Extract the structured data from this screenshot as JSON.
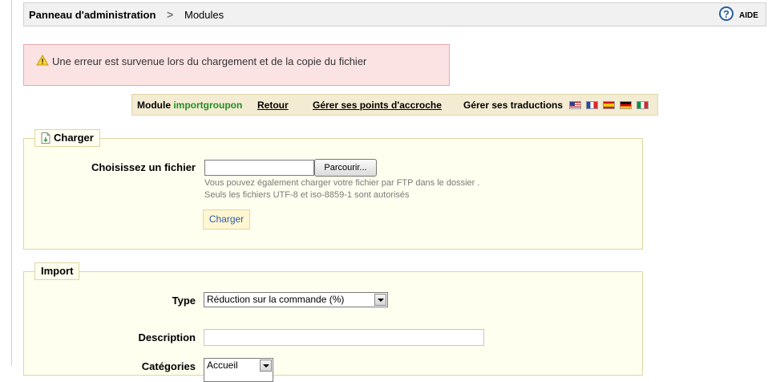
{
  "breadcrumb": {
    "root": "Panneau d'administration",
    "separator": ">",
    "current": "Modules"
  },
  "help": {
    "icon": "help-circle-icon",
    "label": "AIDE"
  },
  "error": {
    "icon": "warning-icon",
    "message": "Une erreur est survenue lors du chargement et de la copie du fichier"
  },
  "toolbar": {
    "module_prefix": "Module",
    "module_name": "importgroupon",
    "back_label": "Retour",
    "hooks_label": "Gérer ses points d'accroche",
    "translations_label": "Gérer ses traductions",
    "flags": [
      "flag-us-icon",
      "flag-fr-icon",
      "flag-es-icon",
      "flag-de-icon",
      "flag-it-icon"
    ]
  },
  "upload_panel": {
    "legend": "Charger",
    "file_label": "Choisissez un fichier",
    "browse_label": "Parcourir...",
    "hint_line1": "Vous pouvez également charger votre fichier par FTP dans le dossier .",
    "hint_line2": "Seuls les fichiers UTF-8 et iso-8859-1 sont autorisés",
    "submit_label": "Charger"
  },
  "import_panel": {
    "legend": "Import",
    "type_label": "Type",
    "type_value": "Réduction sur la commande (%)",
    "description_label": "Description",
    "description_value": "",
    "categories_label": "Catégories",
    "categories_value": "Accueil"
  },
  "colors": {
    "error_bg": "#fbe3e4",
    "toolbar_bg": "#f3ecd3",
    "panel_bg": "#fffff0",
    "module_name": "#268c26",
    "link_blue": "#2b5da8"
  }
}
